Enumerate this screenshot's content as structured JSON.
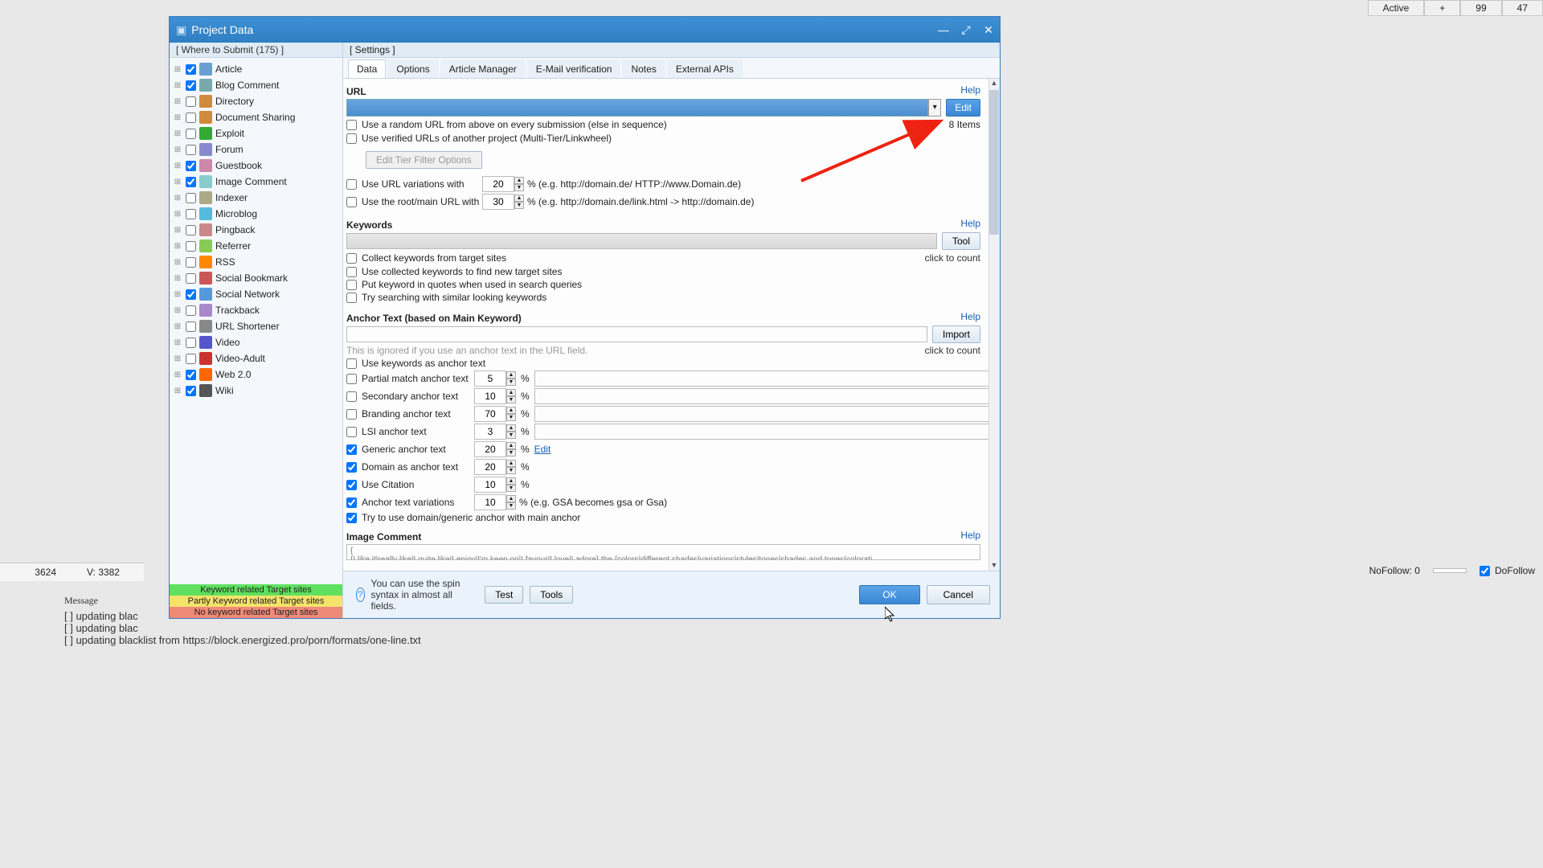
{
  "topbar": {
    "active": "Active",
    "plus": "+",
    "n1": "99",
    "n2": "47"
  },
  "dialog": {
    "title": "Project Data"
  },
  "left": {
    "header": "[ Where to Submit  (175) ]",
    "items": [
      {
        "label": "Article",
        "checked": true
      },
      {
        "label": "Blog Comment",
        "checked": true
      },
      {
        "label": "Directory",
        "checked": false
      },
      {
        "label": "Document Sharing",
        "checked": false
      },
      {
        "label": "Exploit",
        "checked": false
      },
      {
        "label": "Forum",
        "checked": false
      },
      {
        "label": "Guestbook",
        "checked": true
      },
      {
        "label": "Image Comment",
        "checked": true
      },
      {
        "label": "Indexer",
        "checked": false
      },
      {
        "label": "Microblog",
        "checked": false
      },
      {
        "label": "Pingback",
        "checked": false
      },
      {
        "label": "Referrer",
        "checked": false
      },
      {
        "label": "RSS",
        "checked": false
      },
      {
        "label": "Social Bookmark",
        "checked": false
      },
      {
        "label": "Social Network",
        "checked": true
      },
      {
        "label": "Trackback",
        "checked": false
      },
      {
        "label": "URL Shortener",
        "checked": false
      },
      {
        "label": "Video",
        "checked": false
      },
      {
        "label": "Video-Adult",
        "checked": false
      },
      {
        "label": "Web 2.0",
        "checked": true
      },
      {
        "label": "Wiki",
        "checked": true
      }
    ],
    "legend1": "Keyword related Target sites",
    "legend2": "Partly Keyword related Target sites",
    "legend3": "No keyword related Target sites"
  },
  "right": {
    "header": "[ Settings ]",
    "tabs": [
      "Data",
      "Options",
      "Article Manager",
      "E-Mail verification",
      "Notes",
      "External APIs"
    ],
    "activeTab": 0
  },
  "url": {
    "label": "URL",
    "help": "Help",
    "edit": "Edit",
    "itemsCount": "8 Items",
    "opt_random": "Use a random URL from above on every submission (else in sequence)",
    "opt_verified": "Use verified URLs of another project (Multi-Tier/Linkwheel)",
    "tierFilter": "Edit Tier Filter Options",
    "opt_variations": "Use URL variations with",
    "variations_val": "20",
    "variations_hint": "% (e.g. http://domain.de/ HTTP://www.Domain.de)",
    "opt_root": "Use the root/main URL with",
    "root_val": "30",
    "root_hint": "% (e.g. http://domain.de/link.html -> http://domain.de)"
  },
  "keywords": {
    "label": "Keywords",
    "help": "Help",
    "tool": "Tool",
    "count_link": "click to count",
    "opt_collect": "Collect keywords from target sites",
    "opt_usecollected": "Use collected keywords to find new target sites",
    "opt_quotes": "Put keyword in quotes when used in search queries",
    "opt_similar": "Try searching with similar looking keywords"
  },
  "anchor": {
    "label": "Anchor Text (based on Main Keyword)",
    "help": "Help",
    "import": "Import",
    "ignore_hint": "This is ignored if you use an anchor text in the URL field.",
    "count_link": "click to count",
    "opt_kwanchor": "Use keywords as anchor text",
    "opt_partial": "Partial match anchor text",
    "partial_val": "5",
    "opt_secondary": "Secondary anchor text",
    "secondary_val": "10",
    "opt_branding": "Branding anchor text",
    "branding_val": "70",
    "opt_lsi": "LSI anchor text",
    "lsi_val": "3",
    "opt_generic": "Generic anchor text",
    "generic_val": "20",
    "generic_edit": "Edit",
    "opt_domain": "Domain as anchor text",
    "domain_val": "20",
    "opt_citation": "Use Citation",
    "citation_val": "10",
    "opt_variations": "Anchor text variations",
    "variations_val": "10",
    "variations_hint": "% (e.g. GSA becomes gsa or Gsa)",
    "opt_trydomain": "Try to use domain/generic anchor with main anchor",
    "pct": "%"
  },
  "image": {
    "label": "Image Comment",
    "help": "Help",
    "snippet": "{\n{I like it|really like|I quite like|I enjoy|I'm keen on|I favour|I love|I adore} the {colors|different shades|variations|styles|tones|shades and tones|colorati"
  },
  "footer": {
    "tip": "You can use the spin syntax in almost all fields.",
    "test": "Test",
    "tools": "Tools",
    "ok": "OK",
    "cancel": "Cancel"
  },
  "bg": {
    "stat1": "3624",
    "stat2": "V: 3382",
    "msgheader": "Message",
    "log1": "[ ] updating blac",
    "log2": "[ ] updating blac",
    "log3": "[ ] updating blacklist from https://block.energized.pro/porn/formats/one-line.txt",
    "nofollow": "NoFollow:  0",
    "dofollow": "DoFollow"
  }
}
